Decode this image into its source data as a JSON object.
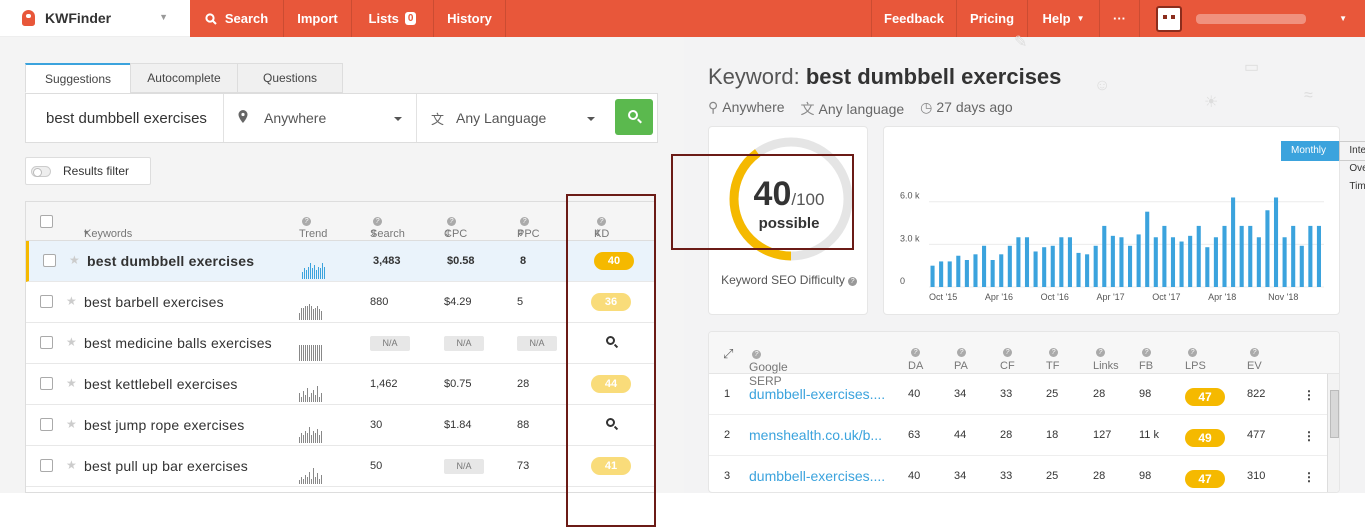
{
  "app": {
    "name": "KWFinder"
  },
  "topnav": {
    "search": "Search",
    "import": "Import",
    "lists": "Lists",
    "lists_count": "0",
    "history": "History",
    "feedback": "Feedback",
    "pricing": "Pricing",
    "help": "Help",
    "more": "···"
  },
  "search_tabs": [
    "Suggestions",
    "Autocomplete",
    "Questions"
  ],
  "search": {
    "query": "best dumbbell exercises",
    "location": "Anywhere",
    "language": "Any Language"
  },
  "results_filter": "Results filter",
  "table": {
    "headers": {
      "keywords": "Keywords",
      "trend": "Trend",
      "search": "Search",
      "cpc": "CPC",
      "ppc": "PPC",
      "kd": "KD"
    },
    "rows": [
      {
        "keyword": "best dumbbell exercises",
        "trend": [
          4,
          6,
          5,
          7,
          9,
          6,
          8,
          5,
          7,
          6,
          9,
          7
        ],
        "search": "3,483",
        "cpc": "$0.58",
        "ppc": "8",
        "kd": "40"
      },
      {
        "keyword": "best barbell exercises",
        "trend": [
          4,
          7,
          7,
          8,
          8,
          9,
          8,
          6,
          7,
          8,
          6,
          5
        ],
        "search": "880",
        "cpc": "$4.29",
        "ppc": "5",
        "kd": "36"
      },
      {
        "keyword": "best medicine balls exercises",
        "trend": [
          1,
          1,
          1,
          1,
          1,
          1,
          1,
          1,
          1,
          1,
          1,
          1
        ],
        "search": "N/A",
        "cpc": "N/A",
        "ppc": "N/A",
        "kd": ""
      },
      {
        "keyword": "best kettlebell exercises",
        "trend": [
          5,
          3,
          6,
          4,
          8,
          3,
          5,
          7,
          4,
          9,
          3,
          5
        ],
        "search": "1,462",
        "cpc": "$0.75",
        "ppc": "28",
        "kd": "44"
      },
      {
        "keyword": "best jump rope exercises",
        "trend": [
          3,
          5,
          4,
          6,
          5,
          8,
          4,
          6,
          5,
          7,
          4,
          6
        ],
        "search": "30",
        "cpc": "$1.84",
        "ppc": "88",
        "kd": ""
      },
      {
        "keyword": "best pull up bar exercises",
        "trend": [
          2,
          4,
          3,
          5,
          4,
          7,
          3,
          9,
          4,
          6,
          3,
          5
        ],
        "search": "50",
        "cpc": "N/A",
        "ppc": "73",
        "kd": "41"
      }
    ]
  },
  "detail": {
    "label": "Keyword:",
    "keyword": "best dumbbell exercises",
    "location": "Anywhere",
    "language": "Any language",
    "age": "27 days ago",
    "difficulty": {
      "score": "40",
      "max": "/100",
      "label": "possible",
      "value": 0.4,
      "caption": "Keyword SEO Difficulty"
    },
    "chart_buttons": [
      "Monthly Search Volumes",
      "Interest Over Time"
    ]
  },
  "chart_data": {
    "type": "bar",
    "title": "",
    "yticks": [
      "6.0 k",
      "3.0 k",
      "0"
    ],
    "xlabels": [
      "Oct '15",
      "Apr '16",
      "Oct '16",
      "Apr '17",
      "Oct '17",
      "Apr '18",
      "Nov '18"
    ],
    "ylim": [
      0,
      7600
    ],
    "values": [
      1500,
      1800,
      1800,
      2200,
      1900,
      2300,
      2900,
      1900,
      2300,
      2900,
      3500,
      3500,
      2500,
      2800,
      2900,
      3500,
      3500,
      2400,
      2300,
      2900,
      4300,
      3600,
      3500,
      2900,
      3700,
      5300,
      3500,
      4300,
      3500,
      3200,
      3600,
      4300,
      2800,
      3500,
      4300,
      6300,
      4300,
      4300,
      3500,
      5400,
      6300,
      3500,
      4300,
      2900,
      4300,
      4300
    ]
  },
  "serp": {
    "headers": {
      "title": "Google SERP",
      "da": "DA",
      "pa": "PA",
      "cf": "CF",
      "tf": "TF",
      "links": "Links",
      "fb": "FB",
      "lps": "LPS",
      "ev": "EV"
    },
    "rows": [
      {
        "n": "1",
        "url": "dumbbell-exercises....",
        "da": "40",
        "pa": "34",
        "cf": "33",
        "tf": "25",
        "links": "28",
        "fb": "98",
        "lps": "47",
        "ev": "822"
      },
      {
        "n": "2",
        "url": "menshealth.co.uk/b...",
        "da": "63",
        "pa": "44",
        "cf": "28",
        "tf": "18",
        "links": "127",
        "fb": "11 k",
        "lps": "49",
        "ev": "477"
      },
      {
        "n": "3",
        "url": "dumbbell-exercises....",
        "da": "40",
        "pa": "34",
        "cf": "33",
        "tf": "25",
        "links": "28",
        "fb": "98",
        "lps": "47",
        "ev": "310"
      }
    ]
  },
  "colors": {
    "brand": "#e8573a",
    "accent": "#3ba3dd",
    "go": "#5bb94e",
    "kd_yellow": "#f5b900",
    "kd_light": "#f9dc7a"
  }
}
